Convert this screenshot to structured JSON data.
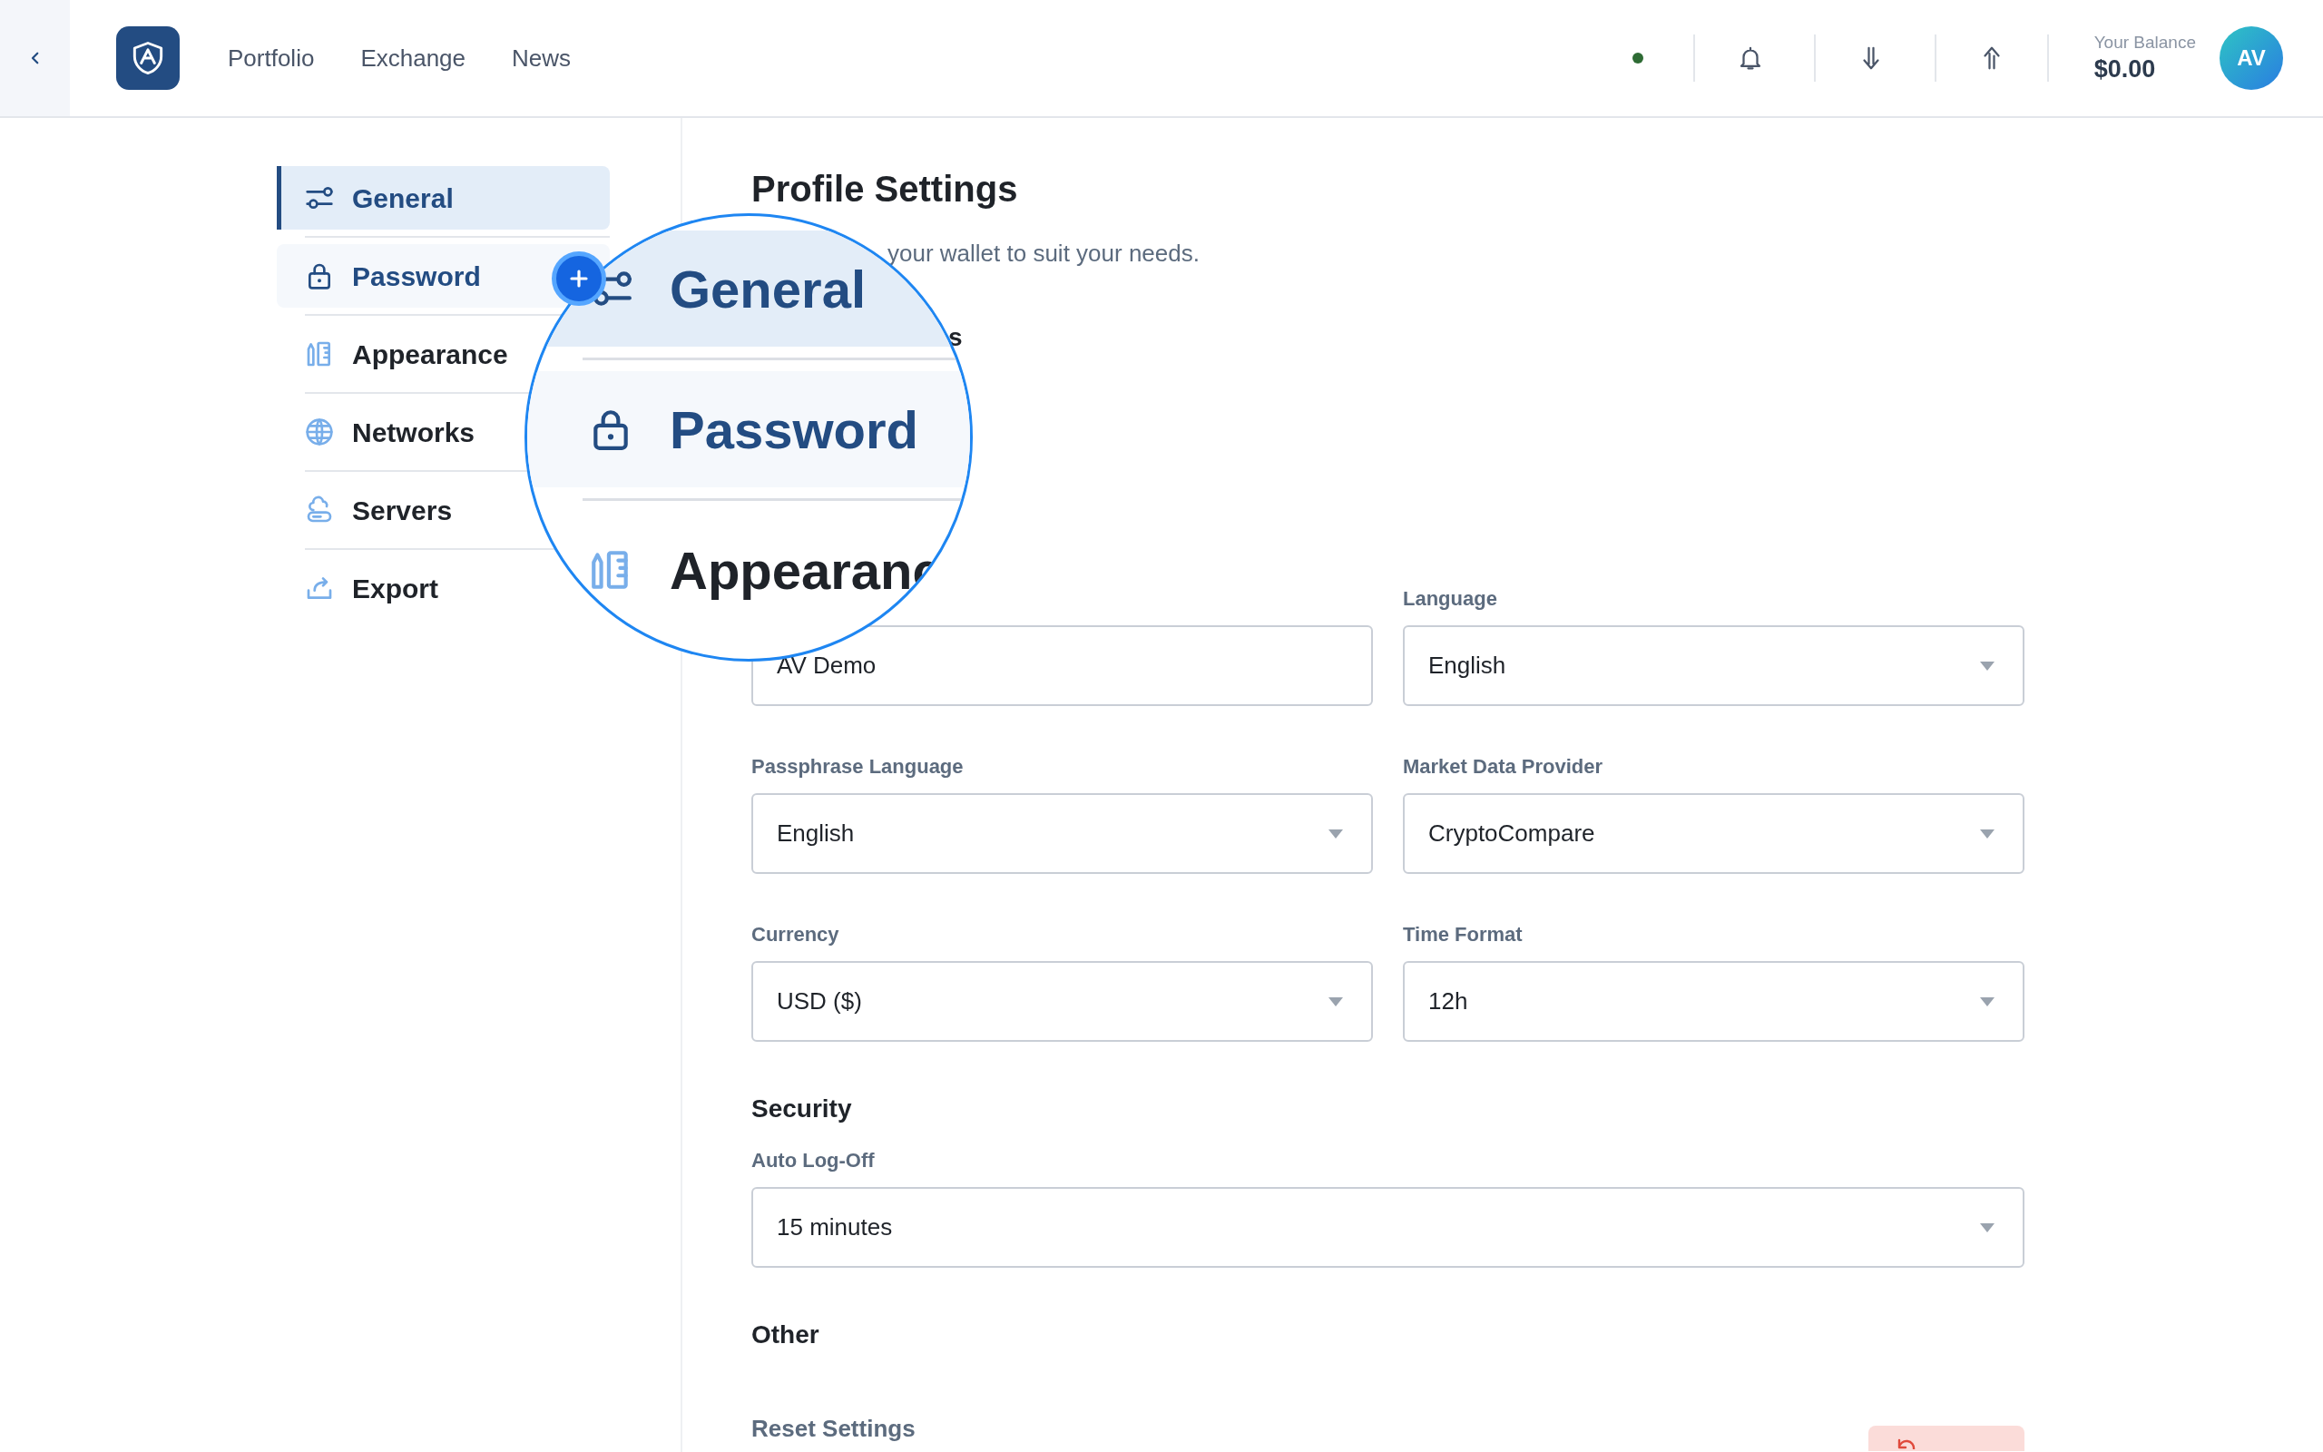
{
  "top_bar": {
    "nav": [
      "Portfolio",
      "Exchange",
      "News"
    ],
    "connected": true,
    "balance_label": "Your Balance",
    "balance": "$0.00",
    "avatar": "AV"
  },
  "sidebar": {
    "items": [
      {
        "label": "General",
        "selected": true
      },
      {
        "label": "Password",
        "selected": false,
        "hovered": true
      },
      {
        "label": "Appearance",
        "selected": false,
        "hovered": false
      },
      {
        "label": "Networks",
        "selected": false,
        "hovered": false
      },
      {
        "label": "Servers",
        "selected": false,
        "hovered": false
      },
      {
        "label": "Export",
        "selected": false,
        "hovered": false
      }
    ]
  },
  "magnifier": {
    "items": [
      {
        "label": "General",
        "selected": true
      },
      {
        "label": "Password",
        "selected": false,
        "hovered": true
      },
      {
        "label": "Appearanc",
        "selected": false,
        "hovered": false
      }
    ]
  },
  "page": {
    "title": "Profile Settings",
    "subtitle": "your wallet to suit your needs.",
    "section_heading": "s",
    "fields": [
      {
        "kind": "text",
        "value": "AV Demo"
      },
      {
        "kind": "select",
        "label": "Language",
        "value": "English"
      },
      {
        "kind": "select",
        "label": "Passphrase Language",
        "value": "English"
      },
      {
        "kind": "select",
        "label": "Market Data Provider",
        "value": "CryptoCompare"
      },
      {
        "kind": "select",
        "label": "Currency",
        "value": "USD ($)"
      },
      {
        "kind": "select",
        "label": "Time Format",
        "value": "12h"
      }
    ],
    "security": {
      "heading": "Security",
      "fields": [
        {
          "kind": "select",
          "label": "Auto Log-Off",
          "value": "15 minutes"
        }
      ]
    },
    "other": {
      "heading": "Other",
      "reset_label": "Reset Settings"
    }
  }
}
